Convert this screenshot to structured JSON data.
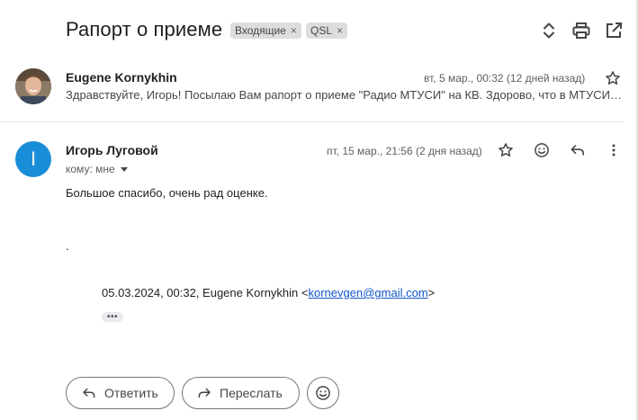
{
  "thread": {
    "subject": "Рапорт о приеме",
    "labels": [
      {
        "name": "Входящие"
      },
      {
        "name": "QSL"
      }
    ],
    "label_remove_glyph": "×"
  },
  "header_icons": [
    "expand-collapse-icon",
    "print-icon",
    "open-in-new-window-icon"
  ],
  "message1": {
    "sender": "Eugene Kornykhin",
    "date": "вт, 5 мар., 00:32 (12 дней назад)",
    "snippet": "Здравствуйте, Игорь! Посылаю Вам рапорт о приеме \"Радио МТУСИ\" на КВ. Здорово, что в МТУСИ возродили радиовещание!"
  },
  "message2": {
    "avatar_letter": "I",
    "sender": "Игорь Луговой",
    "to_line": "кому: мне",
    "date": "пт, 15 мар., 21:56 (2 дня назад)",
    "body": "Большое спасибо, очень рад оценке.",
    "dot_line": ".",
    "quote_prefix": "05.03.2024, 00:32, Eugene Kornykhin <",
    "quote_email": "kornevgen@gmail.com",
    "quote_suffix": ">",
    "ellipsis": "•••"
  },
  "actions": {
    "reply_label": "Ответить",
    "forward_label": "Переслать"
  },
  "colors": {
    "avatar2_bg": "#1a8dd8",
    "link": "#1155cc",
    "chip_bg": "#dddddd"
  }
}
